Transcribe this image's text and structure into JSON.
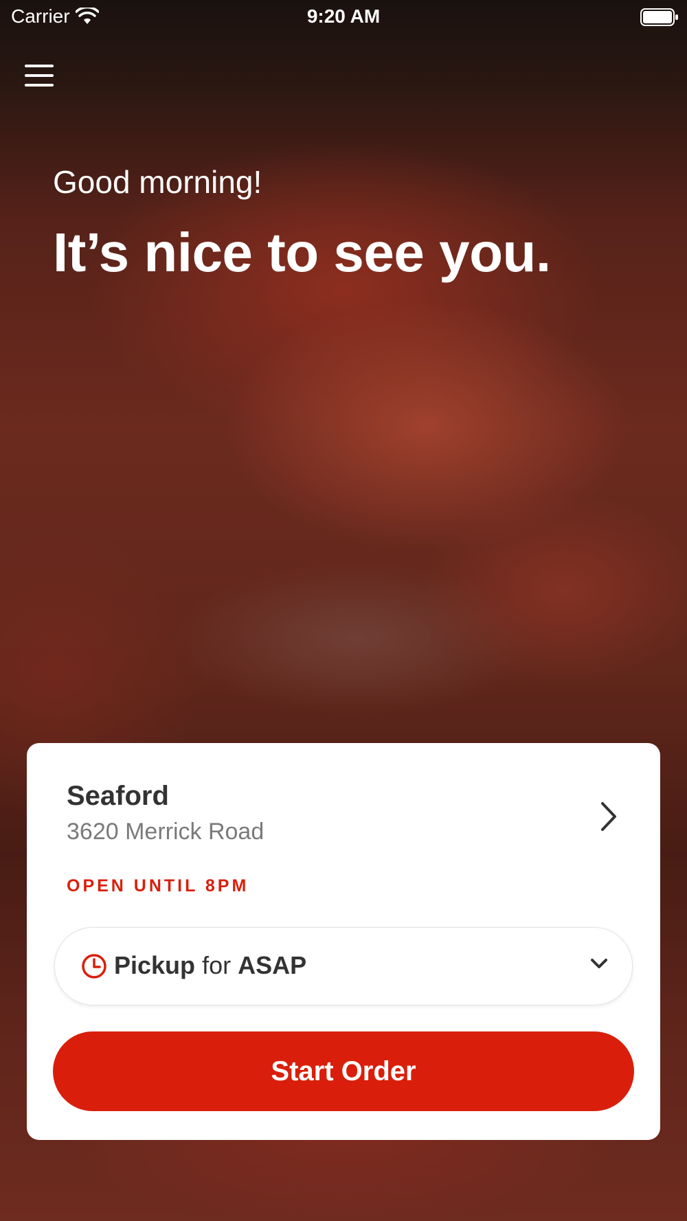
{
  "status_bar": {
    "carrier": "Carrier",
    "time": "9:20 AM"
  },
  "header": {
    "menu_icon": "hamburger-menu-icon"
  },
  "greeting": {
    "small": "Good morning!",
    "large": "It’s nice to see you."
  },
  "location_card": {
    "store_name": "Seaford",
    "store_address": "3620 Merrick Road",
    "open_status": "OPEN UNTIL 8PM",
    "order_type": "Pickup",
    "order_connector": "for",
    "order_time": "ASAP",
    "start_order_label": "Start Order"
  },
  "colors": {
    "accent": "#d91f0b",
    "card_background": "#ffffff",
    "text_dark": "#333333",
    "text_muted": "#7a7a7a"
  }
}
